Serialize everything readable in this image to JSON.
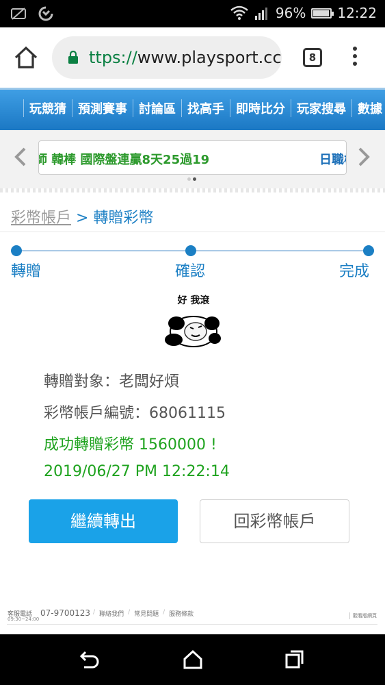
{
  "status_bar": {
    "battery_text": "96%",
    "battery_level": 0.96,
    "time": "12:22",
    "icons": [
      "screen-rotate-icon",
      "sync-icon",
      "wifi-icon",
      "signal-icon",
      "battery-icon"
    ]
  },
  "browser": {
    "url": "ttps://www.playsport.cc",
    "url_scheme": "ttps://",
    "url_host": "www.playsport.cc",
    "tab_count": "8"
  },
  "site_nav": {
    "items": [
      "玩競猜",
      "預測賽事",
      "討論區",
      "找高手",
      "即時比分",
      "玩家搜尋",
      "數據"
    ]
  },
  "ticker": {
    "text": "師 韓棒 國際盤連贏8天25過19",
    "next_text": "日職棒"
  },
  "breadcrumb": {
    "parent": "彩幣帳戶",
    "separator": " > ",
    "current": "轉贈彩幣"
  },
  "steps": [
    {
      "label": "轉贈"
    },
    {
      "label": "確認"
    },
    {
      "label": "完成"
    }
  ],
  "meme": {
    "caption": "好 我滾"
  },
  "result": {
    "recipient_line": "轉贈對象：老闆好煩",
    "account_line": "彩幣帳戶編號：68061115",
    "success_line": "成功轉贈彩幣 1560000 !",
    "timestamp": "2019/06/27 PM 12:22:14"
  },
  "buttons": {
    "continue": "繼續轉出",
    "back_to_account": "回彩幣帳戶"
  },
  "footer": {
    "service_label": "客服電話",
    "service_hours": "09:30~24:00",
    "phone": "07-9700123",
    "links": [
      "聯絡我們",
      "常見問題",
      "服務條款"
    ],
    "right_link": "觀看版網頁"
  },
  "colors": {
    "accent_blue": "#1b7fc4",
    "button_blue": "#1aa2e8",
    "success_green": "#1fa31f",
    "url_green": "#0b8043"
  }
}
